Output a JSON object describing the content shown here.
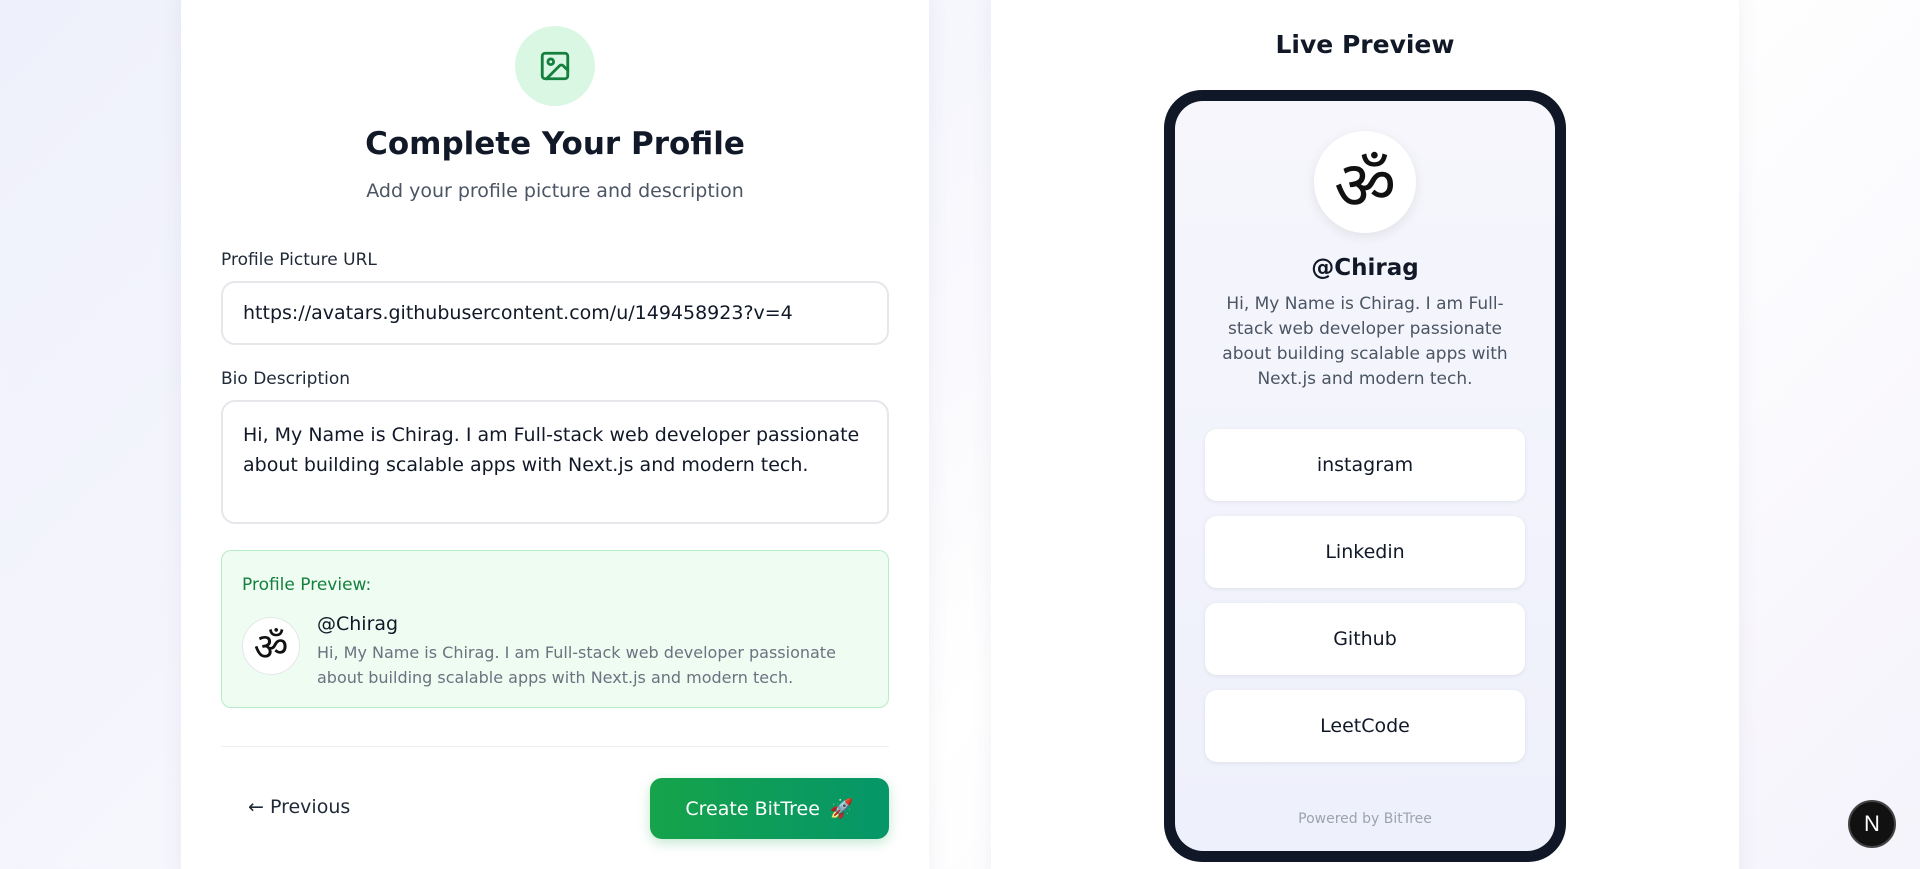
{
  "form": {
    "title": "Complete Your Profile",
    "subtitle": "Add your profile picture and description",
    "picture_label": "Profile Picture URL",
    "picture_value": "https://avatars.githubusercontent.com/u/149458923?v=4",
    "bio_label": "Bio Description",
    "bio_value": "Hi, My Name is Chirag. I am Full-stack web developer passionate about building scalable apps with Next.js and modern tech.",
    "preview": {
      "label": "Profile Preview:",
      "avatar_glyph": "ॐ",
      "name": "@Chirag",
      "bio": "Hi, My Name is Chirag. I am Full-stack web developer passionate about building scalable apps with Next.js and modern tech."
    },
    "previous_label": "← Previous",
    "create_label": "Create BitTree",
    "create_icon": "rocket-icon",
    "create_glyph": "🚀"
  },
  "live_preview": {
    "title": "Live Preview",
    "avatar_glyph": "ॐ",
    "name": "@Chirag",
    "bio": "Hi, My Name is Chirag. I am Full-stack web developer passionate about building scalable apps with Next.js and modern tech.",
    "links": [
      {
        "label": "instagram"
      },
      {
        "label": "Linkedin"
      },
      {
        "label": "Github"
      },
      {
        "label": "LeetCode"
      }
    ],
    "powered_by": "Powered by BitTree"
  },
  "badge": {
    "letter": "N"
  },
  "colors": {
    "accent_green": "#16a34a",
    "icon_bg": "#d9f7e3",
    "phone_frame": "#101828"
  }
}
